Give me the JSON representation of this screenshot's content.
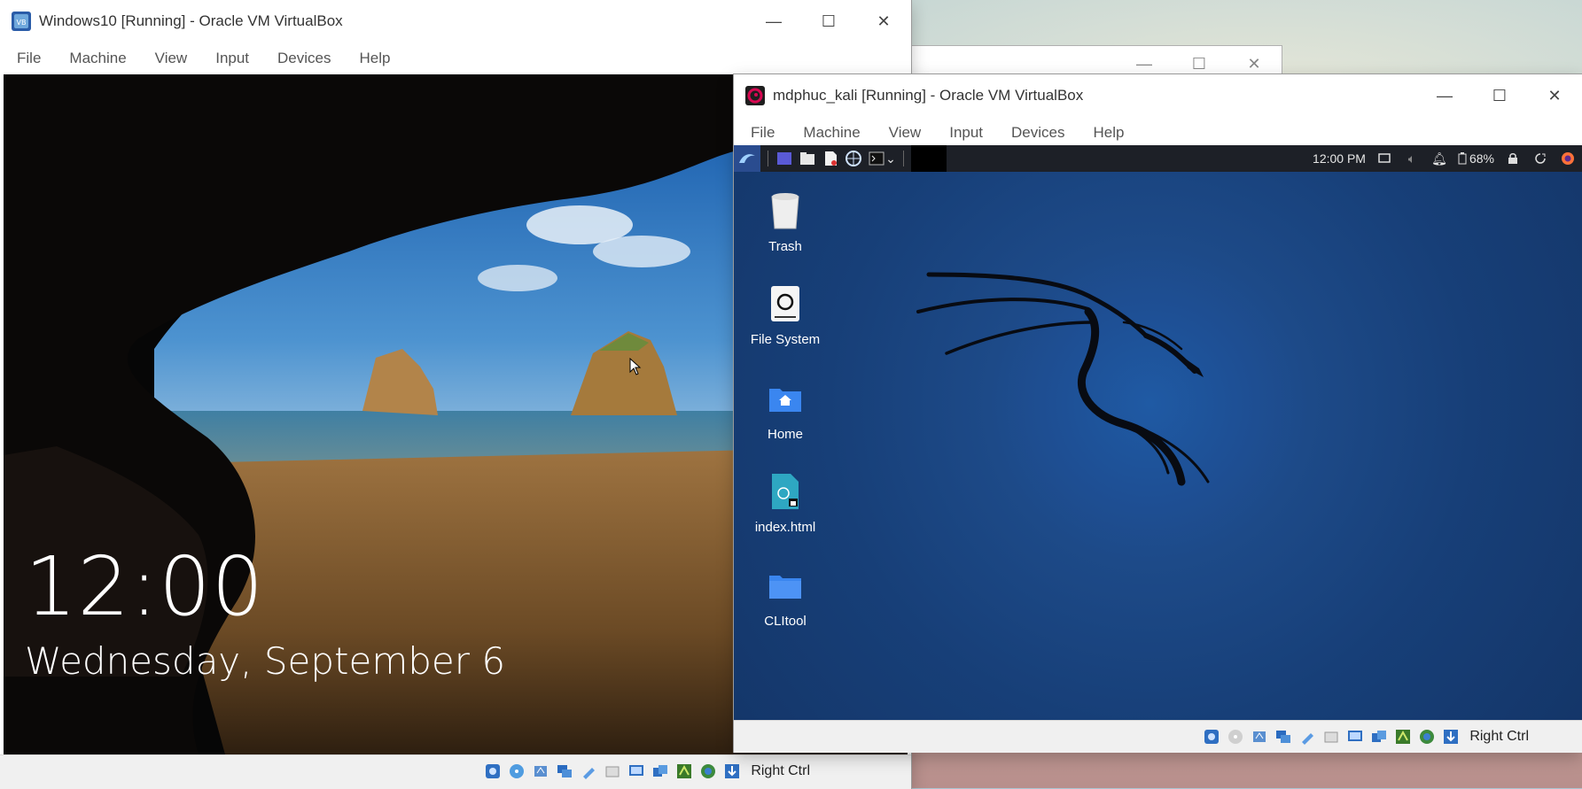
{
  "host": {},
  "background_window": {
    "controls": {
      "minimize": "—",
      "maximize": "☐",
      "close": "✕"
    }
  },
  "win10_vm": {
    "title": "Windows10 [Running] - Oracle VM VirtualBox",
    "menu": [
      "File",
      "Machine",
      "View",
      "Input",
      "Devices",
      "Help"
    ],
    "controls": {
      "minimize": "—",
      "maximize": "☐",
      "close": "✕"
    },
    "lockscreen": {
      "time": "12:00",
      "date": "Wednesday, September 6"
    },
    "statusbar": {
      "host_key": "Right Ctrl",
      "icons": [
        "hard-disk-icon",
        "optical-drive-icon",
        "audio-icon",
        "network-icon",
        "usb-icon",
        "shared-folders-icon",
        "display-icon",
        "video-capture-icon",
        "recording-icon",
        "cpu-icon",
        "mouse-integration-icon",
        "keyboard-icon"
      ]
    }
  },
  "kali_vm": {
    "title": "mdphuc_kali [Running] - Oracle VM VirtualBox",
    "menu": [
      "File",
      "Machine",
      "View",
      "Input",
      "Devices",
      "Help"
    ],
    "controls": {
      "minimize": "—",
      "maximize": "☐",
      "close": "✕"
    },
    "panel": {
      "time": "12:00 PM",
      "battery": "68%"
    },
    "desktop_icons": [
      {
        "label": "Trash",
        "icon": "trash-icon"
      },
      {
        "label": "File System",
        "icon": "drive-icon"
      },
      {
        "label": "Home",
        "icon": "home-folder-icon"
      },
      {
        "label": "index.html",
        "icon": "html-file-icon"
      },
      {
        "label": "CLItool",
        "icon": "folder-icon"
      }
    ],
    "statusbar": {
      "host_key": "Right Ctrl"
    }
  }
}
